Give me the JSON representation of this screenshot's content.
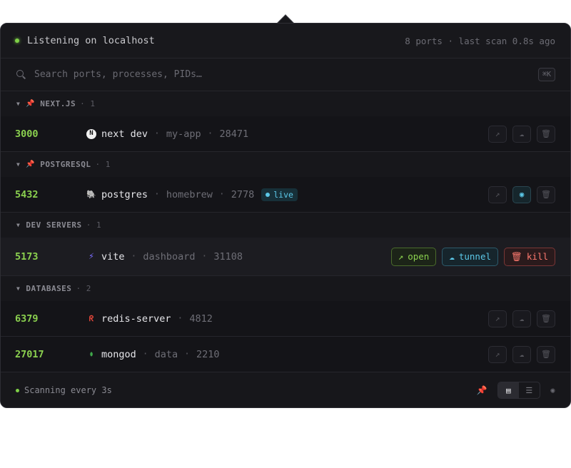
{
  "header": {
    "title": "Listening on localhost",
    "meta": "8 ports · last scan 0.8s ago",
    "status_color": "#7fd047"
  },
  "search": {
    "placeholder": "Search ports, processes, PIDs…",
    "shortcut": "⌘K",
    "value": ""
  },
  "groups": [
    {
      "name": "NEXT.JS",
      "count": "1",
      "pinned": true,
      "rows": [
        {
          "port": "3000",
          "icon": "nextjs-icon",
          "glyph": "N",
          "name": "next dev",
          "project": "my-app",
          "pid": "28471"
        }
      ]
    },
    {
      "name": "POSTGRESQL",
      "count": "1",
      "pinned": true,
      "rows": [
        {
          "port": "5432",
          "icon": "postgres-icon",
          "glyph": "🐘",
          "name": "postgres",
          "project": "homebrew",
          "pid": "2778",
          "badge": "live"
        }
      ]
    },
    {
      "name": "DEV SERVERS",
      "count": "1",
      "pinned": false,
      "rows": [
        {
          "port": "5173",
          "icon": "vite-icon",
          "glyph": "⚡",
          "name": "vite",
          "project": "dashboard",
          "pid": "31108"
        }
      ]
    },
    {
      "name": "DATABASES",
      "count": "2",
      "pinned": false,
      "rows": [
        {
          "port": "6379",
          "icon": "redis-icon",
          "glyph": "ᖇ",
          "name": "redis-server",
          "pid": "4812"
        },
        {
          "port": "27017",
          "icon": "mongodb-icon",
          "glyph": "●",
          "name": "mongod",
          "project": "data",
          "pid": "2210"
        }
      ]
    }
  ],
  "hover_actions": {
    "open": "open",
    "tunnel": "tunnel",
    "kill": "kill"
  },
  "footer": {
    "status": "Scanning every 3s"
  },
  "colors": {
    "port": "#8bd14f",
    "accent_cyan": "#5cc8e8",
    "danger": "#ff7a70"
  }
}
